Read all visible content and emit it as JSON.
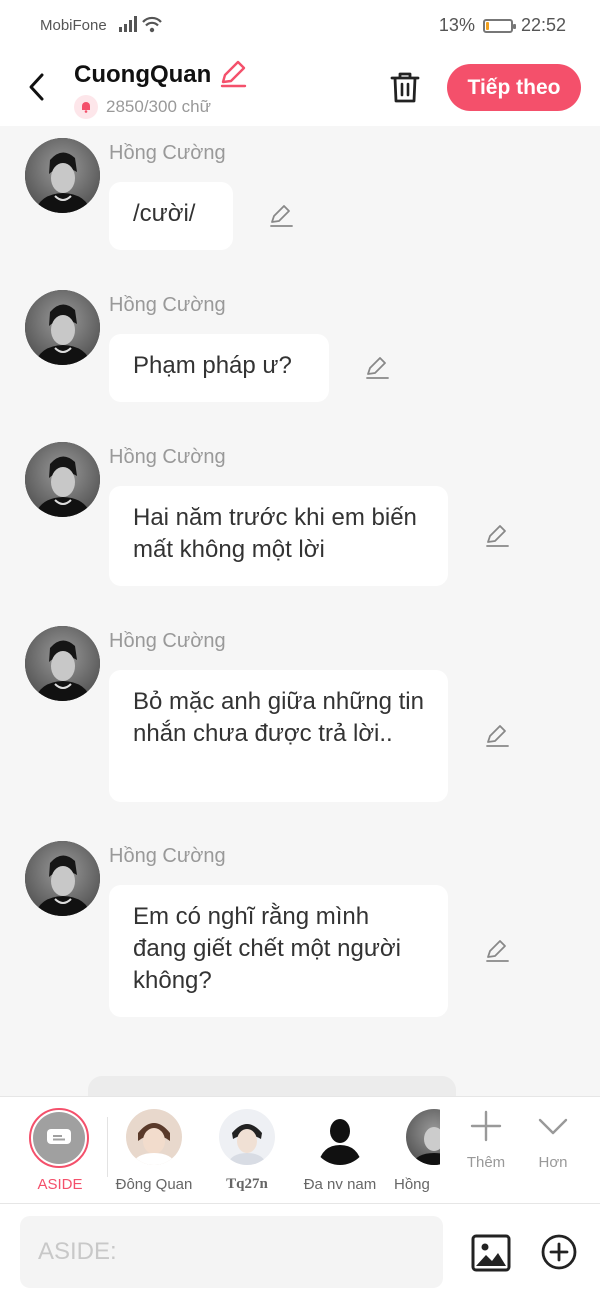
{
  "status": {
    "carrier": "MobiFone",
    "battery": "13%",
    "time": "22:52"
  },
  "header": {
    "title": "CuongQuan",
    "count": "2850/300 chữ",
    "next_label": "Tiếp theo"
  },
  "messages": [
    {
      "sender": "Hồng Cường",
      "text": "/cười/"
    },
    {
      "sender": "Hồng Cường",
      "text": "Phạm pháp ư?"
    },
    {
      "sender": "Hồng Cường",
      "text": "Hai năm trước khi em biến mất không một lời"
    },
    {
      "sender": "Hồng Cường",
      "text": "Bỏ mặc anh giữa những tin nhắn chưa được trả lời.."
    },
    {
      "sender": "Hồng Cường",
      "text": "Em có nghĩ rằng mình đang giết chết một người không?"
    }
  ],
  "characters": [
    {
      "label": "ASIDE"
    },
    {
      "label": "Đông Quan"
    },
    {
      "label": "Tq27n"
    },
    {
      "label": "Đa nv nam"
    },
    {
      "label": "Hồng"
    }
  ],
  "tools": {
    "more_label": "Thêm",
    "expand_label": "Hơn"
  },
  "input": {
    "placeholder": "ASIDE:"
  },
  "colors": {
    "accent": "#f4506b",
    "battery": "#f0a020"
  }
}
